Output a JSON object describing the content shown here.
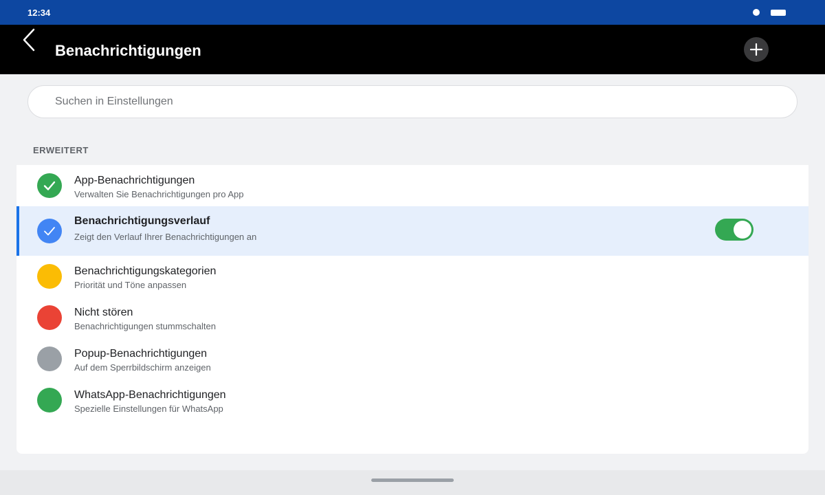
{
  "status_bar": {
    "time": "12:34"
  },
  "app_bar": {
    "title": "Benachrichtigungen"
  },
  "search": {
    "placeholder": "Suchen in Einstellungen",
    "value": ""
  },
  "section": {
    "header": "ERWEITERT"
  },
  "list": {
    "items": [
      {
        "title": "App-Benachrichtigungen",
        "subtitle": "Verwalten Sie Benachrichtigungen pro App",
        "icon": "check-icon",
        "icon_color": "#34a853"
      },
      {
        "title": "Benachrichtigungsverlauf",
        "subtitle": "Zeigt den Verlauf Ihrer Benachrichtigungen an",
        "icon": "check-icon",
        "icon_color": "#4285f4",
        "selected": true,
        "toggle_on": true
      },
      {
        "title": "Benachrichtigungskategorien",
        "subtitle": "Priorität und Töne anpassen",
        "icon": "circle-icon",
        "icon_color": "#fbbc04"
      },
      {
        "title": "Nicht stören",
        "subtitle": "Benachrichtigungen stummschalten",
        "icon": "circle-icon",
        "icon_color": "#ea4335"
      },
      {
        "title": "Popup-Benachrichtigungen",
        "subtitle": "Auf dem Sperrbildschirm anzeigen",
        "icon": "circle-icon",
        "icon_color": "#9aa0a6"
      },
      {
        "title": "WhatsApp-Benachrichtigungen",
        "subtitle": "Spezielle Einstellungen für WhatsApp",
        "icon": "circle-icon",
        "icon_color": "#34a853"
      }
    ]
  },
  "colors": {
    "status_bar": "#0d47a1",
    "app_bar": "#000000",
    "selected_row": "#e6effc",
    "selected_accent": "#1a73e8",
    "toggle_on": "#34a853"
  }
}
